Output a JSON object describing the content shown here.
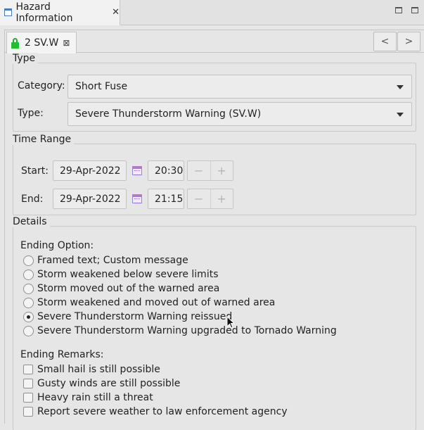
{
  "view_tab": {
    "title": "Hazard Information",
    "close_glyph": "✕"
  },
  "inner_tab": {
    "label": "2 SV.W",
    "close_glyph": "⊠"
  },
  "nav": {
    "prev": "<",
    "next": ">"
  },
  "type_group": {
    "title": "Type",
    "category_label": "Category:",
    "category_value": "Short Fuse",
    "type_label": "Type:",
    "type_value": "Severe Thunderstorm Warning (SV.W)"
  },
  "time_group": {
    "title": "Time Range",
    "start_label": "Start:",
    "start_date": "29-Apr-2022",
    "start_time": "20:30",
    "end_label": "End:",
    "end_date": "29-Apr-2022",
    "end_time": "21:15",
    "minus": "−",
    "plus": "+"
  },
  "details_group": {
    "title": "Details",
    "ending_option_label": "Ending Option:",
    "ending_options": [
      {
        "label": "Framed text; Custom message",
        "selected": false
      },
      {
        "label": "Storm weakened below severe limits",
        "selected": false
      },
      {
        "label": "Storm moved out of the warned area",
        "selected": false
      },
      {
        "label": "Storm weakened and moved out of warned area",
        "selected": false
      },
      {
        "label": "Severe Thunderstorm Warning reissued",
        "selected": true
      },
      {
        "label": "Severe Thunderstorm Warning upgraded to Tornado Warning",
        "selected": false
      }
    ],
    "ending_remarks_label": "Ending Remarks:",
    "ending_remarks": [
      {
        "label": "Small hail is still possible",
        "checked": false
      },
      {
        "label": "Gusty winds are still possible",
        "checked": false
      },
      {
        "label": "Heavy rain still a threat",
        "checked": false
      },
      {
        "label": "Report severe weather to law enforcement agency",
        "checked": false
      }
    ]
  },
  "colors": {
    "lock": "#1fbf2f",
    "background": "#e6e6e6"
  }
}
